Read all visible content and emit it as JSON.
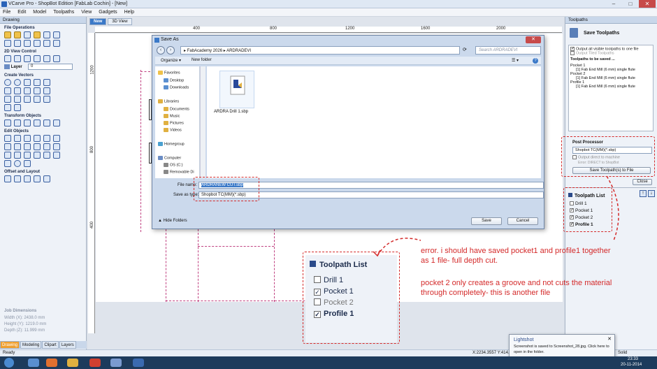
{
  "window": {
    "title": "VCarve Pro - ShopBot Edition [FabLab Cochin] - [New]"
  },
  "menu": [
    "File",
    "Edit",
    "Model",
    "Toolpaths",
    "View",
    "Gadgets",
    "Help"
  ],
  "left_panel": {
    "header": "Drawing",
    "sections": [
      "File Operations",
      "2D View Control",
      "Create Vectors",
      "Transform Objects",
      "Edit Objects",
      "Offset and Layout"
    ],
    "layer_label": "Layer",
    "layer_value": "0",
    "job_dimensions": {
      "title": "Job Dimensions",
      "width": "Width  (X): 2438.0 mm",
      "height": "Height (Y): 1219.0 mm",
      "depth": "Depth  (Z): 11.999 mm"
    },
    "tabs": [
      "Drawing",
      "Modeling",
      "Clipart",
      "Layers"
    ]
  },
  "canvas": {
    "tabs": [
      "New",
      "3D View"
    ],
    "hruler": [
      "400",
      "800",
      "1200",
      "1600",
      "2000"
    ],
    "vruler": [
      "1200",
      "800",
      "400"
    ]
  },
  "dialog": {
    "title": "Save As",
    "path": [
      "FabAcademy 2026",
      "ARDRADEVI"
    ],
    "search_placeholder": "Search ARDRADEVI",
    "organize": "Organize ▾",
    "new_folder": "New folder",
    "nav": {
      "favorites": "Favorites",
      "fav_items": [
        "Desktop",
        "Downloads"
      ],
      "libraries": "Libraries",
      "lib_items": [
        "Documents",
        "Music",
        "Pictures",
        "Videos"
      ],
      "homegroup": "Homegroup",
      "computer": "Computer",
      "comp_items": [
        "OS (C:)",
        "Removable Di"
      ]
    },
    "file": {
      "name": "ARDRA Drill 1.sbp"
    },
    "filename_label": "File name:",
    "filename_value": "ARDRANEW CUT.sbp",
    "savetype_label": "Save as type:",
    "savetype_value": "Shopbot TC(MM)(*.sbp)",
    "hide_folders": "Hide Folders",
    "save": "Save",
    "cancel": "Cancel"
  },
  "right_panel": {
    "header": "Toolpaths",
    "panel_title": "Save Toolpaths",
    "opt_all_visible": "Output all visible toolpaths to one file",
    "opt_visible_text": "Output Tiled Toolpaths",
    "to_be_saved_title": "Toolpaths to be saved ...",
    "saved_lines": [
      "Pocket 1",
      "[1] Fab End Mill (6 mm) single flute",
      "Pocket 2",
      "[1] Fab End Mill (6 mm) single flute",
      "Profile 1",
      "[1] Fab End Mill (6 mm) single flute"
    ],
    "post_processor_title": "Post Processor",
    "post_processor_value": "Shopbot TC(MM)(*.sbp)",
    "output_direct": "Output direct to machine",
    "error_text": "Error: DIRECT to ShopBot",
    "save_button": "Save Toolpath(s) to File",
    "close_button": "Close",
    "list_title": "Toolpath List",
    "list_items": [
      {
        "name": "Drill 1",
        "checked": false,
        "bold": false
      },
      {
        "name": "Pocket 1",
        "checked": true,
        "bold": false
      },
      {
        "name": "Pocket 2",
        "checked": false,
        "bold": false
      },
      {
        "name": "Profile 1",
        "checked": true,
        "bold": true
      }
    ]
  },
  "zoomed_list": {
    "title": "Toolpath List",
    "items": [
      "Drill 1",
      "Pocket 1",
      "Pocket 2",
      "Profile 1"
    ]
  },
  "annotations": {
    "a1": "error. i should have saved pocket1 and profile1 together",
    "a2": "as 1 file- full depth cut.",
    "a3": "pocket 2 only creates a groove and not cuts the material",
    "a4": "through completely- this is another file"
  },
  "status": {
    "left": "Ready",
    "coords": "X:2234.3557 Y:414.96",
    "solid": "Solid"
  },
  "notification": {
    "title": "Lightshot",
    "body1": "Screenshot is saved to Screenshot_28.jpg. Click here to",
    "body2": "open in the folder."
  },
  "clock": {
    "time": "23:33",
    "date": "20-11-2014"
  }
}
